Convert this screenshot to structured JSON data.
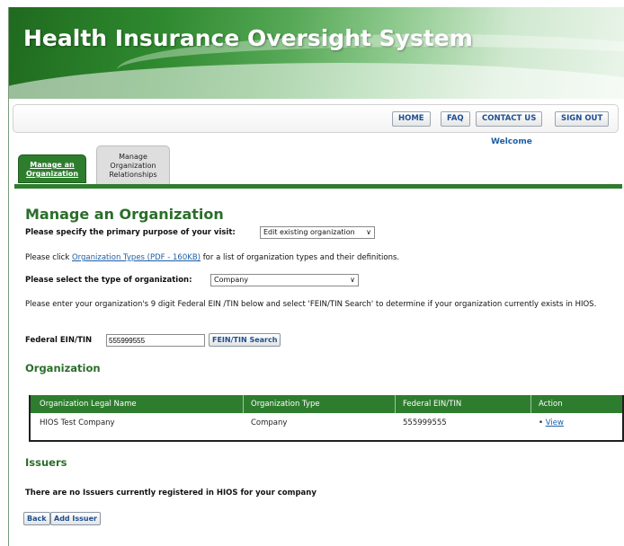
{
  "app": {
    "title": "Health Insurance Oversight System"
  },
  "nav": {
    "home": "HOME",
    "faq": "FAQ",
    "contact": "CONTACT US",
    "signout": "SIGN OUT",
    "welcome": "Welcome"
  },
  "tabs": {
    "active": "Manage an Organization",
    "inactive": "Manage Organization Relationships"
  },
  "page": {
    "heading": "Manage an Organization",
    "purpose_label": "Please specify the primary purpose of your visit:",
    "purpose_value": "Edit existing organization",
    "click_prefix": "Please click",
    "types_link": "Organization Types (PDF - 160KB)",
    "click_suffix": "for a list of organization types and their definitions.",
    "type_label": "Please select the type of organization:",
    "type_value": "Company",
    "ein_instructions": "Please enter your organization's 9 digit Federal EIN /TIN below and select 'FEIN/TIN Search' to determine if your organization currently exists in HIOS.",
    "ein_label": "Federal EIN/TIN",
    "ein_value": "555999555",
    "ein_search": "FEIN/TIN Search"
  },
  "organization": {
    "heading": "Organization",
    "columns": [
      "Organization Legal Name",
      "Organization Type",
      "Federal EIN/TIN",
      "Action"
    ],
    "rows": [
      {
        "name": "HIOS Test Company",
        "type": "Company",
        "ein": "555999555",
        "action": "View"
      }
    ]
  },
  "issuers": {
    "heading": "Issuers",
    "empty_message": "There are no Issuers currently registered in HIOS for your company",
    "back_button": "Back",
    "add_button": "Add Issuer"
  }
}
